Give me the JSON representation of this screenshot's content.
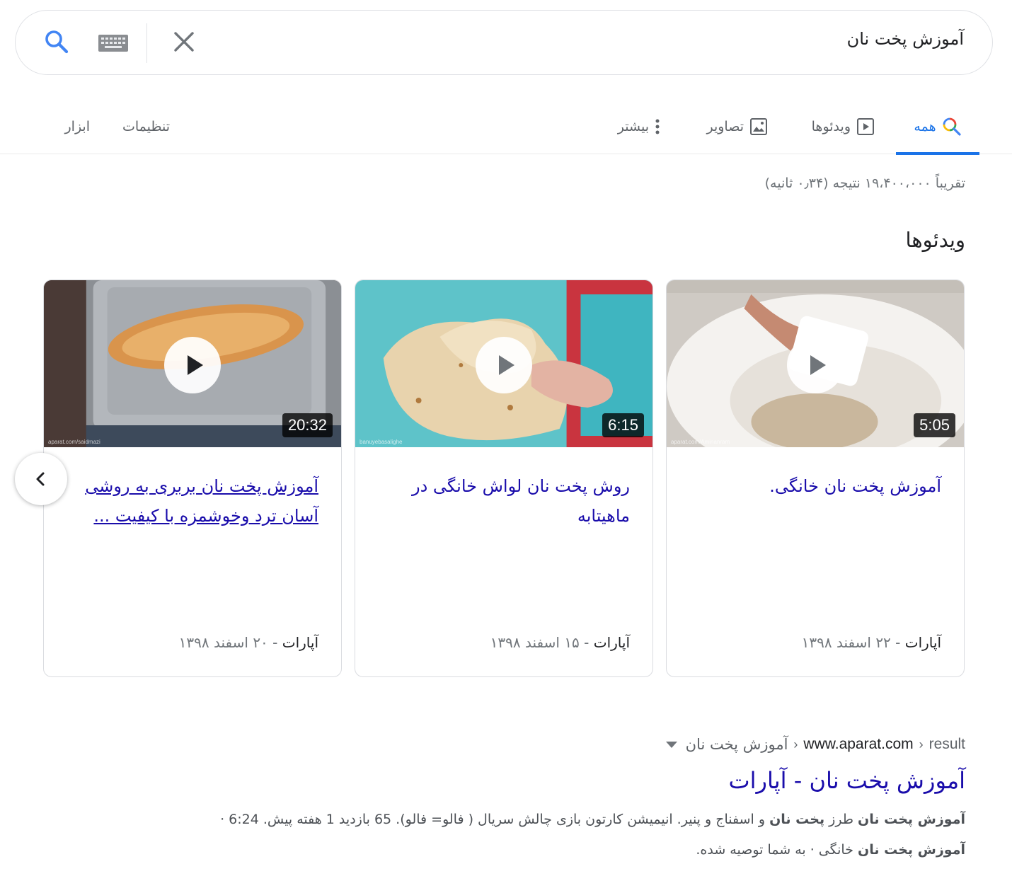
{
  "search": {
    "query": "آموزش پخت نان"
  },
  "tabs": {
    "all": "همه",
    "videos": "ویدئوها",
    "images": "تصاویر",
    "more": "بیشتر",
    "settings": "تنظیمات",
    "tools": "ابزار"
  },
  "result_stats": "تقریباً ۱۹،۴۰۰،۰۰۰ نتیجه (۰٫۳۴ ثانیه)",
  "videos_section": {
    "heading": "ویدئوها",
    "cards": [
      {
        "title": "آموزش پخت نان خانگی.",
        "duration": "5:05",
        "source": "آپارات",
        "date": "۲۲ اسفند ۱۳۹۸",
        "watermark": "aparat.com/Aminanram"
      },
      {
        "title": "روش پخت نان لواش خانگی در ماهیتابه",
        "duration": "6:15",
        "source": "آپارات",
        "date": "۱۵ اسفند ۱۳۹۸",
        "watermark": "banuyebasalighe"
      },
      {
        "title": "آموزش پخت نان بربری به روشی آسان ترد وخوشمزه با کیفیت ...",
        "duration": "20:32",
        "source": "آپارات",
        "date": "۲۰ اسفند ۱۳۹۸",
        "watermark": "aparat.com/saidmazi"
      }
    ],
    "date_separator": "-"
  },
  "organic_result": {
    "breadcrumb": {
      "domain": "www.aparat.com",
      "segment1": "result",
      "segment2": "آموزش پخت نان"
    },
    "title": "آموزش پخت نان - آپارات",
    "snippet_line1": {
      "b1": "آموزش پخت نان",
      "t1": " طرز ",
      "b2": "پخت نان",
      "t2": " و اسفناج و پنیر. انیمیشن کارتون بازی چالش سریال ( فالو= فالو). 65 بازدید 1 هفته پیش. 6:24 ·"
    },
    "snippet_line2": {
      "b1": "آموزش پخت نان",
      "t1": " خانگی · به شما توصیه شده."
    }
  },
  "colors": {
    "accent": "#1a73e8",
    "link": "#1a0dab",
    "muted": "#70757a"
  },
  "icons": [
    "search-icon",
    "keyboard-icon",
    "close-icon",
    "video-tab-icon",
    "image-tab-icon",
    "more-dots-icon",
    "play-icon",
    "chevron-left-icon",
    "dropdown-arrow-icon"
  ]
}
